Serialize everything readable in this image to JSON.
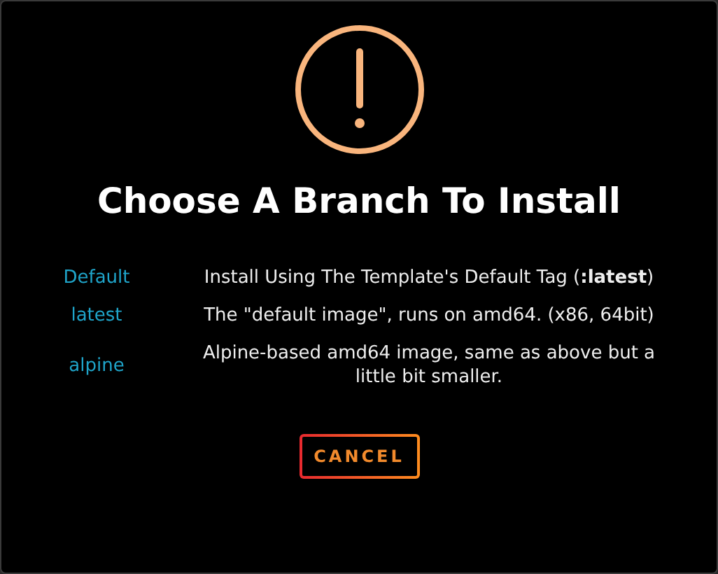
{
  "dialog": {
    "title": "Choose A Branch To Install",
    "branches": [
      {
        "name": "Default",
        "description": "Install Using The Template's Default Tag (**:latest**)"
      },
      {
        "name": "latest",
        "description": "The \"default image\", runs on amd64. (x86, 64bit)"
      },
      {
        "name": "alpine",
        "description": "Alpine-based amd64 image, same as above but a little bit smaller."
      }
    ],
    "buttons": [
      "CANCEL"
    ]
  }
}
